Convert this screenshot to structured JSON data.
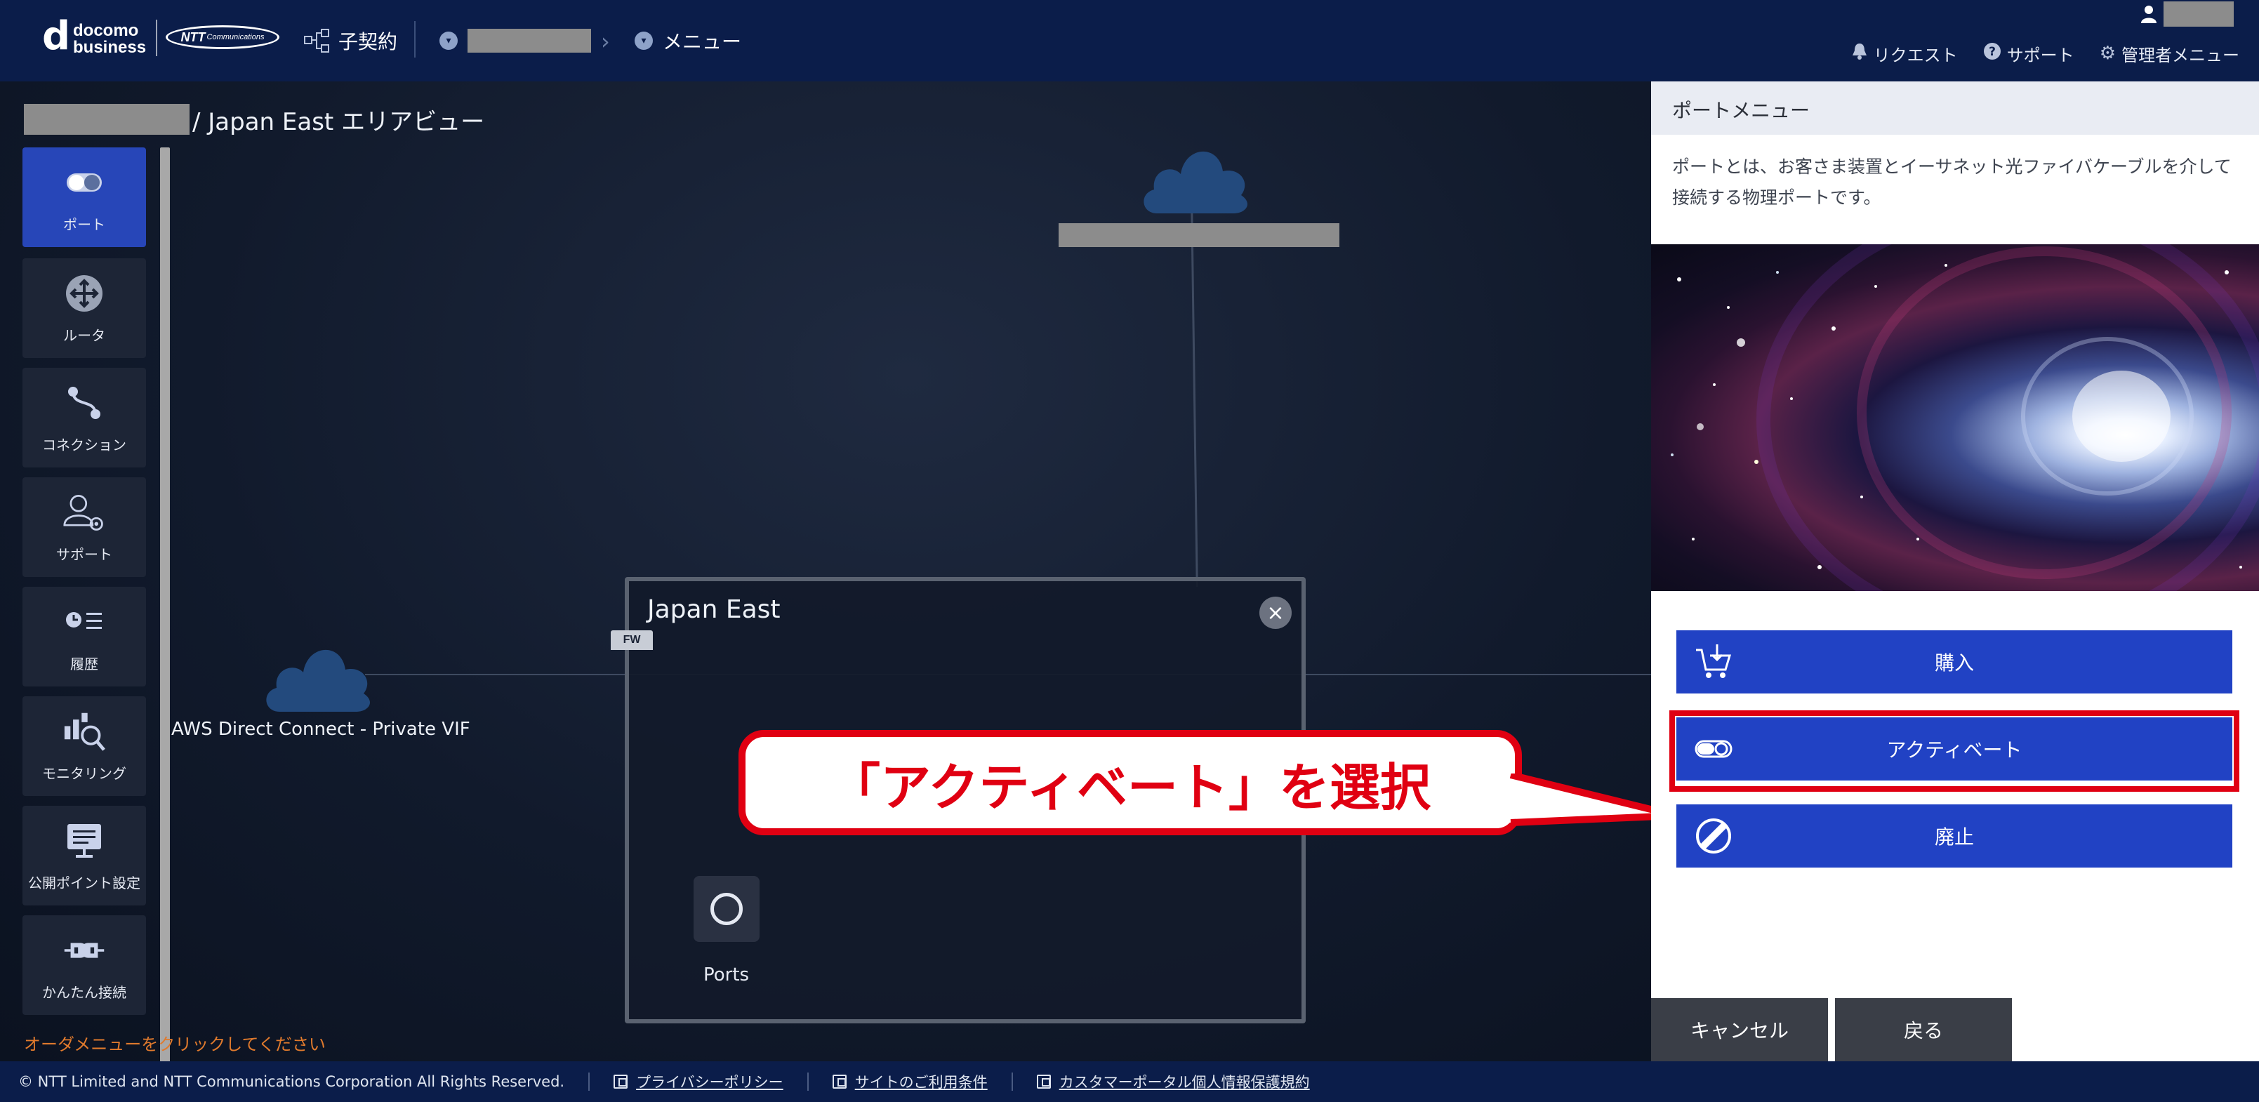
{
  "header": {
    "logo_docomo_line1": "docomo",
    "logo_docomo_line2": "business",
    "logo_ntt": "NTT",
    "logo_ntt_sub": "Communications",
    "contract_label": "子契約",
    "menu_label": "メニュー",
    "links": {
      "request": "リクエスト",
      "support": "サポート",
      "admin": "管理者メニュー"
    }
  },
  "breadcrumb": {
    "suffix": "/ Japan East エリアビュー"
  },
  "sidebar": {
    "items": [
      {
        "label": "ポート",
        "icon": "port-toggle-icon"
      },
      {
        "label": "ルータ",
        "icon": "router-icon"
      },
      {
        "label": "コネクション",
        "icon": "connection-icon"
      },
      {
        "label": "サポート",
        "icon": "support-user-icon"
      },
      {
        "label": "履歴",
        "icon": "history-icon"
      },
      {
        "label": "モニタリング",
        "icon": "monitoring-icon"
      },
      {
        "label": "公開ポイント設定",
        "icon": "public-point-icon"
      },
      {
        "label": "かんたん接続",
        "icon": "easy-connect-icon"
      }
    ]
  },
  "order_hint": "オーダメニューをクリックしてください",
  "topology": {
    "aws_label": "AWS Direct Connect - Private VIF",
    "area_title": "Japan East",
    "fw_badge": "FW",
    "ports_label": "Ports"
  },
  "callout": {
    "text": "「アクティベート」を選択"
  },
  "panel": {
    "title": "ポートメニュー",
    "description": "ポートとは、お客さま装置とイーサネット光ファイバケーブルを介して接続する物理ポートです。",
    "buttons": {
      "purchase": "購入",
      "activate": "アクティベート",
      "abolish": "廃止"
    },
    "cancel": "キャンセル",
    "back": "戻る"
  },
  "footer": {
    "copyright": "© NTT Limited and NTT Communications Corporation All Rights Reserved.",
    "privacy": "プライバシーポリシー",
    "terms": "サイトのご利用条件",
    "portal_privacy": "カスタマーポータル個人情報保護規約"
  },
  "colors": {
    "header_bg": "#0b1d4a",
    "active_blue": "#2746b8",
    "button_blue": "#2142c4",
    "highlight_red": "#e00012",
    "hint_orange": "#e07a2d"
  }
}
